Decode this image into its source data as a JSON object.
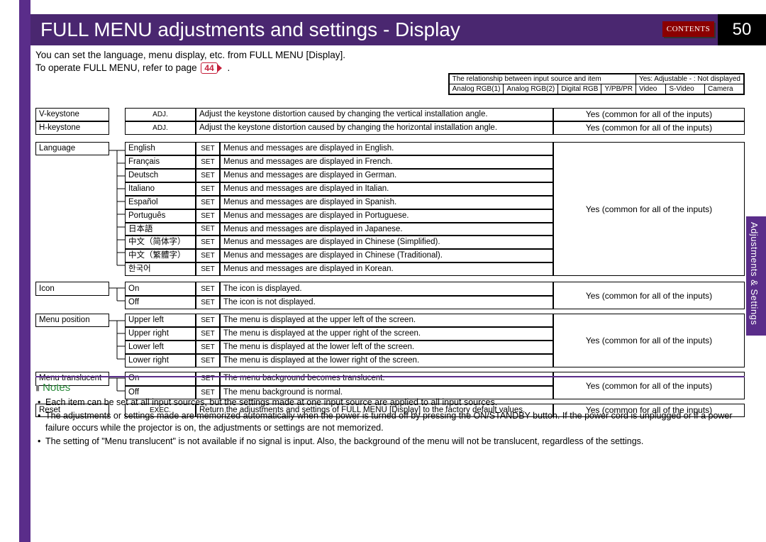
{
  "header": {
    "title": "FULL MENU adjustments and settings - Display",
    "contents_button": "CONTENTS",
    "page_number": "50"
  },
  "side_tab": "Adjustments & Settings",
  "intro": {
    "line1": "You can set the language, menu display, etc. from FULL MENU [Display].",
    "line2_prefix": "To operate FULL MENU, refer to page ",
    "page_ref": "44",
    "line2_suffix": " ."
  },
  "legend": {
    "top_left": "The relationship between input source and item",
    "top_right": "Yes: Adjustable   - : Not displayed",
    "cols": [
      "Analog RGB(1)",
      "Analog RGB(2)",
      "Digital RGB",
      "Y/PB/PR",
      "Video",
      "S-Video",
      "Camera"
    ]
  },
  "rows": {
    "vkeystone": {
      "label": "V-keystone",
      "tag": "ADJ.",
      "desc": "Adjust the keystone distortion caused by changing the vertical installation angle.",
      "common": "Yes (common for all of the inputs)"
    },
    "hkeystone": {
      "label": "H-keystone",
      "tag": "ADJ.",
      "desc": "Adjust the keystone distortion caused by changing the horizontal installation angle.",
      "common": "Yes (common for all of the inputs)"
    },
    "language": {
      "label": "Language",
      "common": "Yes (common for all of the inputs)",
      "options": [
        {
          "name": "English",
          "set": "SET",
          "desc": "Menus and messages are displayed in English."
        },
        {
          "name": "Français",
          "set": "SET",
          "desc": "Menus and messages are displayed in French."
        },
        {
          "name": "Deutsch",
          "set": "SET",
          "desc": "Menus and messages are displayed in German."
        },
        {
          "name": "Italiano",
          "set": "SET",
          "desc": "Menus and messages are displayed in Italian."
        },
        {
          "name": "Español",
          "set": "SET",
          "desc": "Menus and messages are displayed in Spanish."
        },
        {
          "name": "Português",
          "set": "SET",
          "desc": "Menus and messages are displayed in Portuguese."
        },
        {
          "name": "日本語",
          "set": "SET",
          "desc": "Menus and messages are displayed in Japanese."
        },
        {
          "name": "中文（简体字）",
          "set": "SET",
          "desc": "Menus and messages are displayed in Chinese (Simplified)."
        },
        {
          "name": "中文（繁體字）",
          "set": "SET",
          "desc": "Menus and messages are displayed in Chinese (Traditional)."
        },
        {
          "name": "한국어",
          "set": "SET",
          "desc": "Menus and messages are displayed in Korean."
        }
      ]
    },
    "icon": {
      "label": "Icon",
      "common": "Yes (common for all of the inputs)",
      "options": [
        {
          "name": "On",
          "set": "SET",
          "desc": "The icon is displayed."
        },
        {
          "name": "Off",
          "set": "SET",
          "desc": "The icon is not displayed."
        }
      ]
    },
    "menu_position": {
      "label": "Menu position",
      "common": "Yes (common for all of the inputs)",
      "options": [
        {
          "name": "Upper left",
          "set": "SET",
          "desc": "The menu is displayed at the upper left of the screen."
        },
        {
          "name": "Upper right",
          "set": "SET",
          "desc": "The menu is displayed at the upper right of the screen."
        },
        {
          "name": "Lower left",
          "set": "SET",
          "desc": "The menu is displayed at the lower left of the screen."
        },
        {
          "name": "Lower right",
          "set": "SET",
          "desc": "The menu is displayed at the lower right of the screen."
        }
      ]
    },
    "menu_translucent": {
      "label": "Menu translucent",
      "common": "Yes (common for all of the inputs)",
      "options": [
        {
          "name": "On",
          "set": "SET",
          "desc": "The menu background becomes translucent."
        },
        {
          "name": "Off",
          "set": "SET",
          "desc": "The menu background is normal."
        }
      ]
    },
    "reset": {
      "label": "Reset",
      "tag": "EXEC.",
      "desc": "Return the adjustments and settings of FULL MENU [Display] to the factory default values.",
      "common": "Yes (common for all of the inputs)"
    }
  },
  "notes": {
    "heading": "Notes",
    "items": [
      "Each item can be set at all input sources, but the settings made at one input source are applied to all input sources.",
      "The adjustments or settings made are memorized automatically when the power is turned off by pressing the ON/STANDBY button. If the power cord is unplugged or if a power failure occurs while the projector is on, the adjustments or settings are not memorized.",
      "The setting of \"Menu translucent\" is not available if no signal is input. Also, the background of the menu will not be translucent, regardless of the settings."
    ]
  }
}
